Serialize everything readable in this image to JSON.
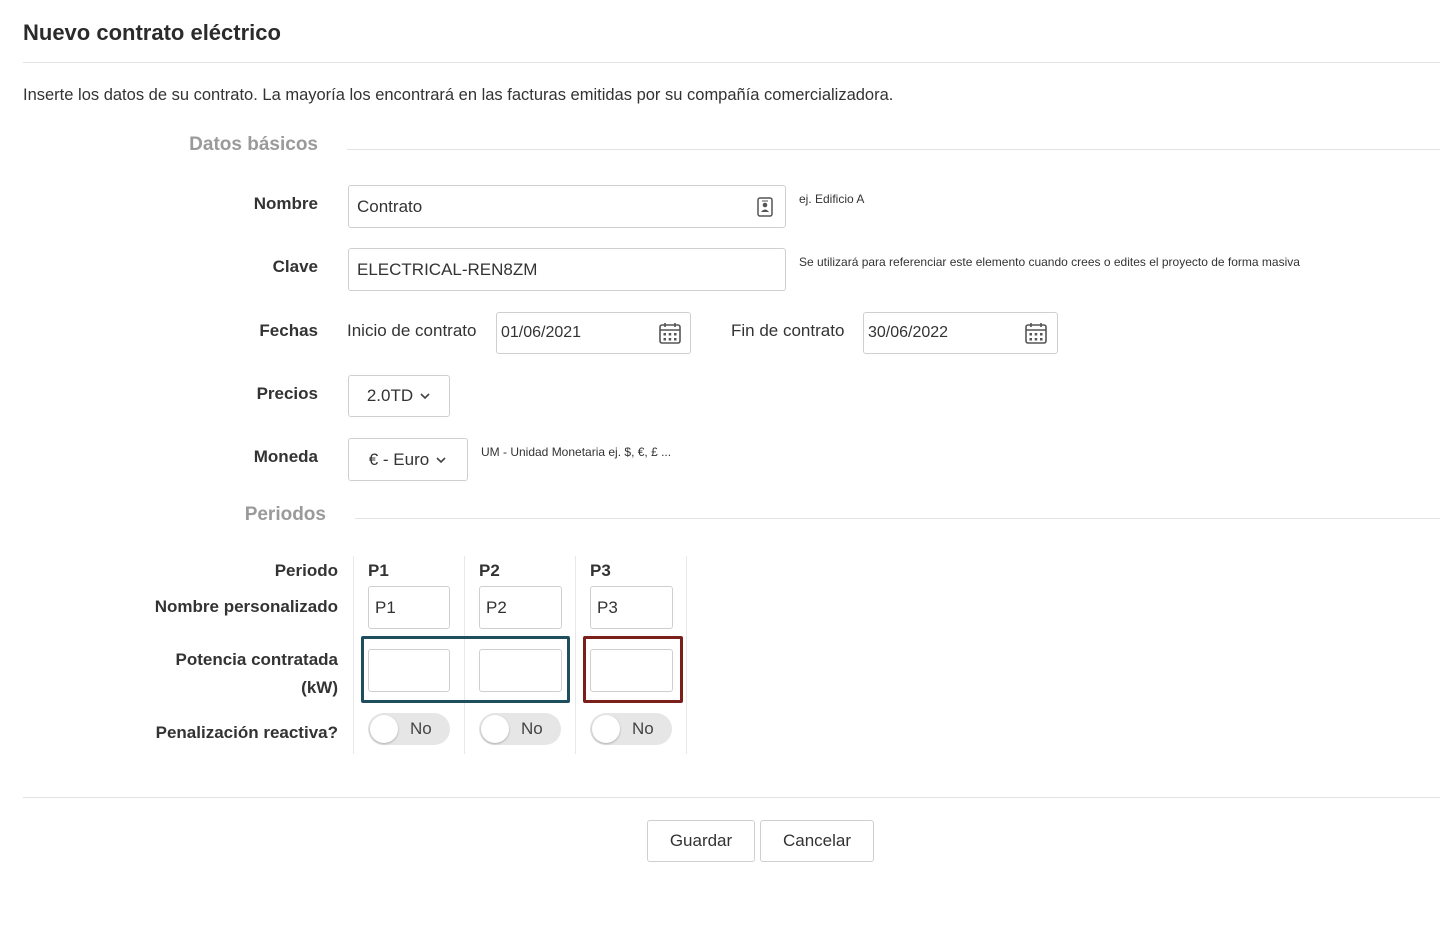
{
  "page": {
    "title": "Nuevo contrato eléctrico",
    "intro": "Inserte los datos de su contrato. La mayoría los encontrará en las facturas emitidas por su compañía comercializadora."
  },
  "basic": {
    "section_title": "Datos básicos",
    "nombre": {
      "label": "Nombre",
      "value": "Contrato",
      "help": "ej. Edificio A"
    },
    "clave": {
      "label": "Clave",
      "value": "ELECTRICAL-REN8ZM",
      "help": "Se utilizará para referenciar este elemento cuando crees o edites el proyecto de forma masiva"
    },
    "fechas": {
      "label": "Fechas",
      "start_label": "Inicio de contrato",
      "start_value": "01/06/2021",
      "end_label": "Fin de contrato",
      "end_value": "30/06/2022"
    },
    "precios": {
      "label": "Precios",
      "value": "2.0TD"
    },
    "moneda": {
      "label": "Moneda",
      "value": "€ - Euro",
      "help": "UM - Unidad Monetaria ej. $, €, £ ..."
    }
  },
  "periods": {
    "section_title": "Periodos",
    "row_labels": {
      "periodo": "Periodo",
      "nombre": "Nombre personalizado",
      "potencia_line1": "Potencia contratada",
      "potencia_line2": "(kW)",
      "penalizacion": "Penalización reactiva?"
    },
    "columns": [
      {
        "header": "P1",
        "custom_name": "P1",
        "power": "",
        "reactive": "No"
      },
      {
        "header": "P2",
        "custom_name": "P2",
        "power": "",
        "reactive": "No"
      },
      {
        "header": "P3",
        "custom_name": "P3",
        "power": "",
        "reactive": "No"
      }
    ]
  },
  "actions": {
    "save": "Guardar",
    "cancel": "Cancelar"
  },
  "colors": {
    "highlight_blue": "#1f4e5f",
    "highlight_red": "#7a1f1a"
  }
}
